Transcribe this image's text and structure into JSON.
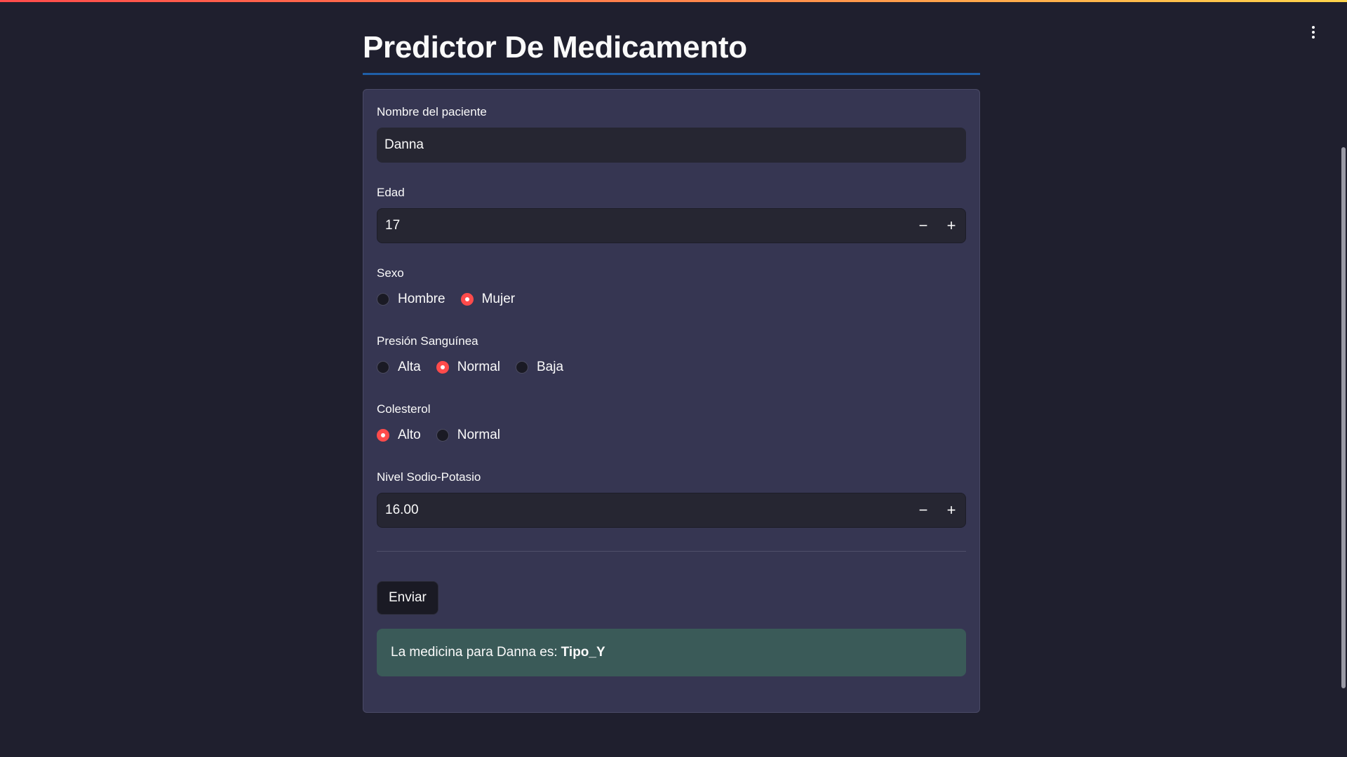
{
  "app": {
    "title": "Predictor De Medicamento"
  },
  "form": {
    "name": {
      "label": "Nombre del paciente",
      "value": "Danna"
    },
    "age": {
      "label": "Edad",
      "value": "17",
      "decrement": "−",
      "increment": "+"
    },
    "sex": {
      "label": "Sexo",
      "options": [
        {
          "label": "Hombre",
          "selected": false
        },
        {
          "label": "Mujer",
          "selected": true
        }
      ]
    },
    "blood_pressure": {
      "label": "Presión Sanguínea",
      "options": [
        {
          "label": "Alta",
          "selected": false
        },
        {
          "label": "Normal",
          "selected": true
        },
        {
          "label": "Baja",
          "selected": false
        }
      ]
    },
    "cholesterol": {
      "label": "Colesterol",
      "options": [
        {
          "label": "Alto",
          "selected": true
        },
        {
          "label": "Normal",
          "selected": false
        }
      ]
    },
    "sodium_potassium": {
      "label": "Nivel Sodio-Potasio",
      "value": "16.00",
      "decrement": "−",
      "increment": "+"
    },
    "submit_label": "Enviar"
  },
  "result": {
    "prefix": "La medicina para Danna es:",
    "value": "Tipo_Y"
  },
  "colors": {
    "accent": "#ff4b4b",
    "background": "#1f1f2e",
    "card": "#363652",
    "result_bg": "#3a5a58"
  }
}
